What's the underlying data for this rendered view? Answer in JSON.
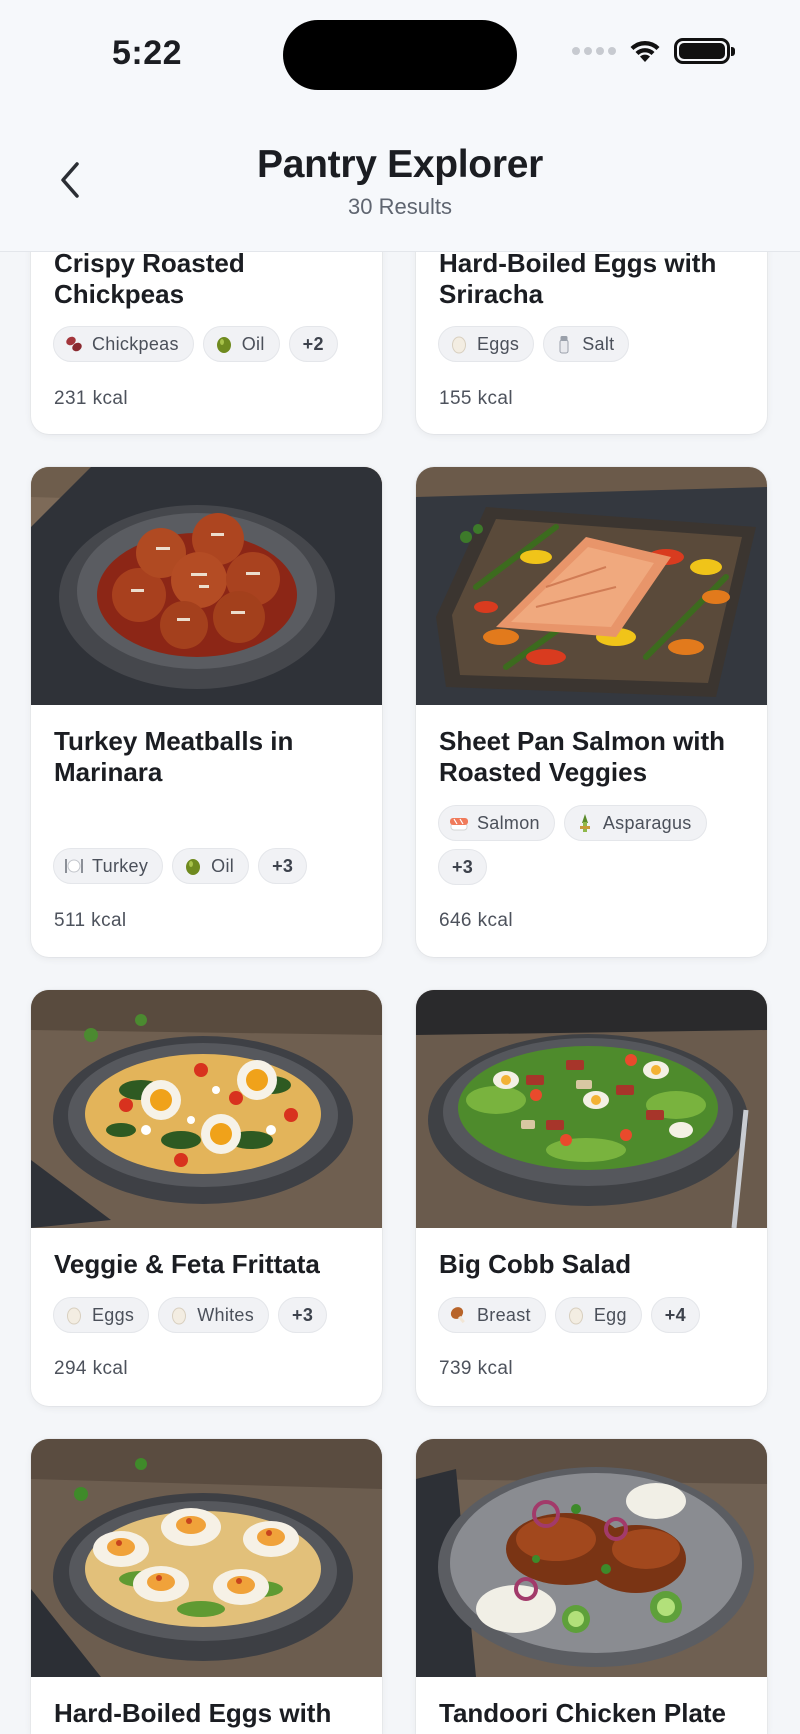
{
  "status_bar": {
    "time": "5:22"
  },
  "header": {
    "title": "Pantry Explorer",
    "subtitle": "30 Results"
  },
  "recipes": [
    {
      "title": "Crispy Roasted Chickpeas",
      "ingredients": [
        {
          "icon": "beans-icon",
          "label": "Chickpeas"
        },
        {
          "icon": "olive-icon",
          "label": "Oil"
        }
      ],
      "more": "+2",
      "kcal": "231 kcal"
    },
    {
      "title": "Hard-Boiled Eggs with Sriracha",
      "ingredients": [
        {
          "icon": "egg-icon",
          "label": "Eggs"
        },
        {
          "icon": "salt-shaker-icon",
          "label": "Salt"
        }
      ],
      "more": "",
      "kcal": "155 kcal"
    },
    {
      "title": "Turkey Meatballs in Marinara",
      "ingredients": [
        {
          "icon": "plate-icon",
          "label": "Turkey"
        },
        {
          "icon": "olive-icon",
          "label": "Oil"
        }
      ],
      "more": "+3",
      "kcal": "511 kcal"
    },
    {
      "title": "Sheet Pan Salmon with Roasted Veggies",
      "ingredients": [
        {
          "icon": "sushi-icon",
          "label": "Salmon"
        },
        {
          "icon": "asparagus-icon",
          "label": "Asparagus"
        }
      ],
      "more": "+3",
      "kcal": "646 kcal"
    },
    {
      "title": "Veggie & Feta Frittata",
      "ingredients": [
        {
          "icon": "egg-icon",
          "label": "Eggs"
        },
        {
          "icon": "egg-icon",
          "label": "Whites"
        }
      ],
      "more": "+3",
      "kcal": "294 kcal"
    },
    {
      "title": "Big Cobb Salad",
      "ingredients": [
        {
          "icon": "drumstick-icon",
          "label": "Breast"
        },
        {
          "icon": "egg-icon",
          "label": "Egg"
        }
      ],
      "more": "+4",
      "kcal": "739 kcal"
    },
    {
      "title": "Hard-Boiled Eggs with",
      "ingredients": [],
      "more": "",
      "kcal": ""
    },
    {
      "title": "Tandoori Chicken Plate",
      "ingredients": [],
      "more": "",
      "kcal": ""
    }
  ]
}
